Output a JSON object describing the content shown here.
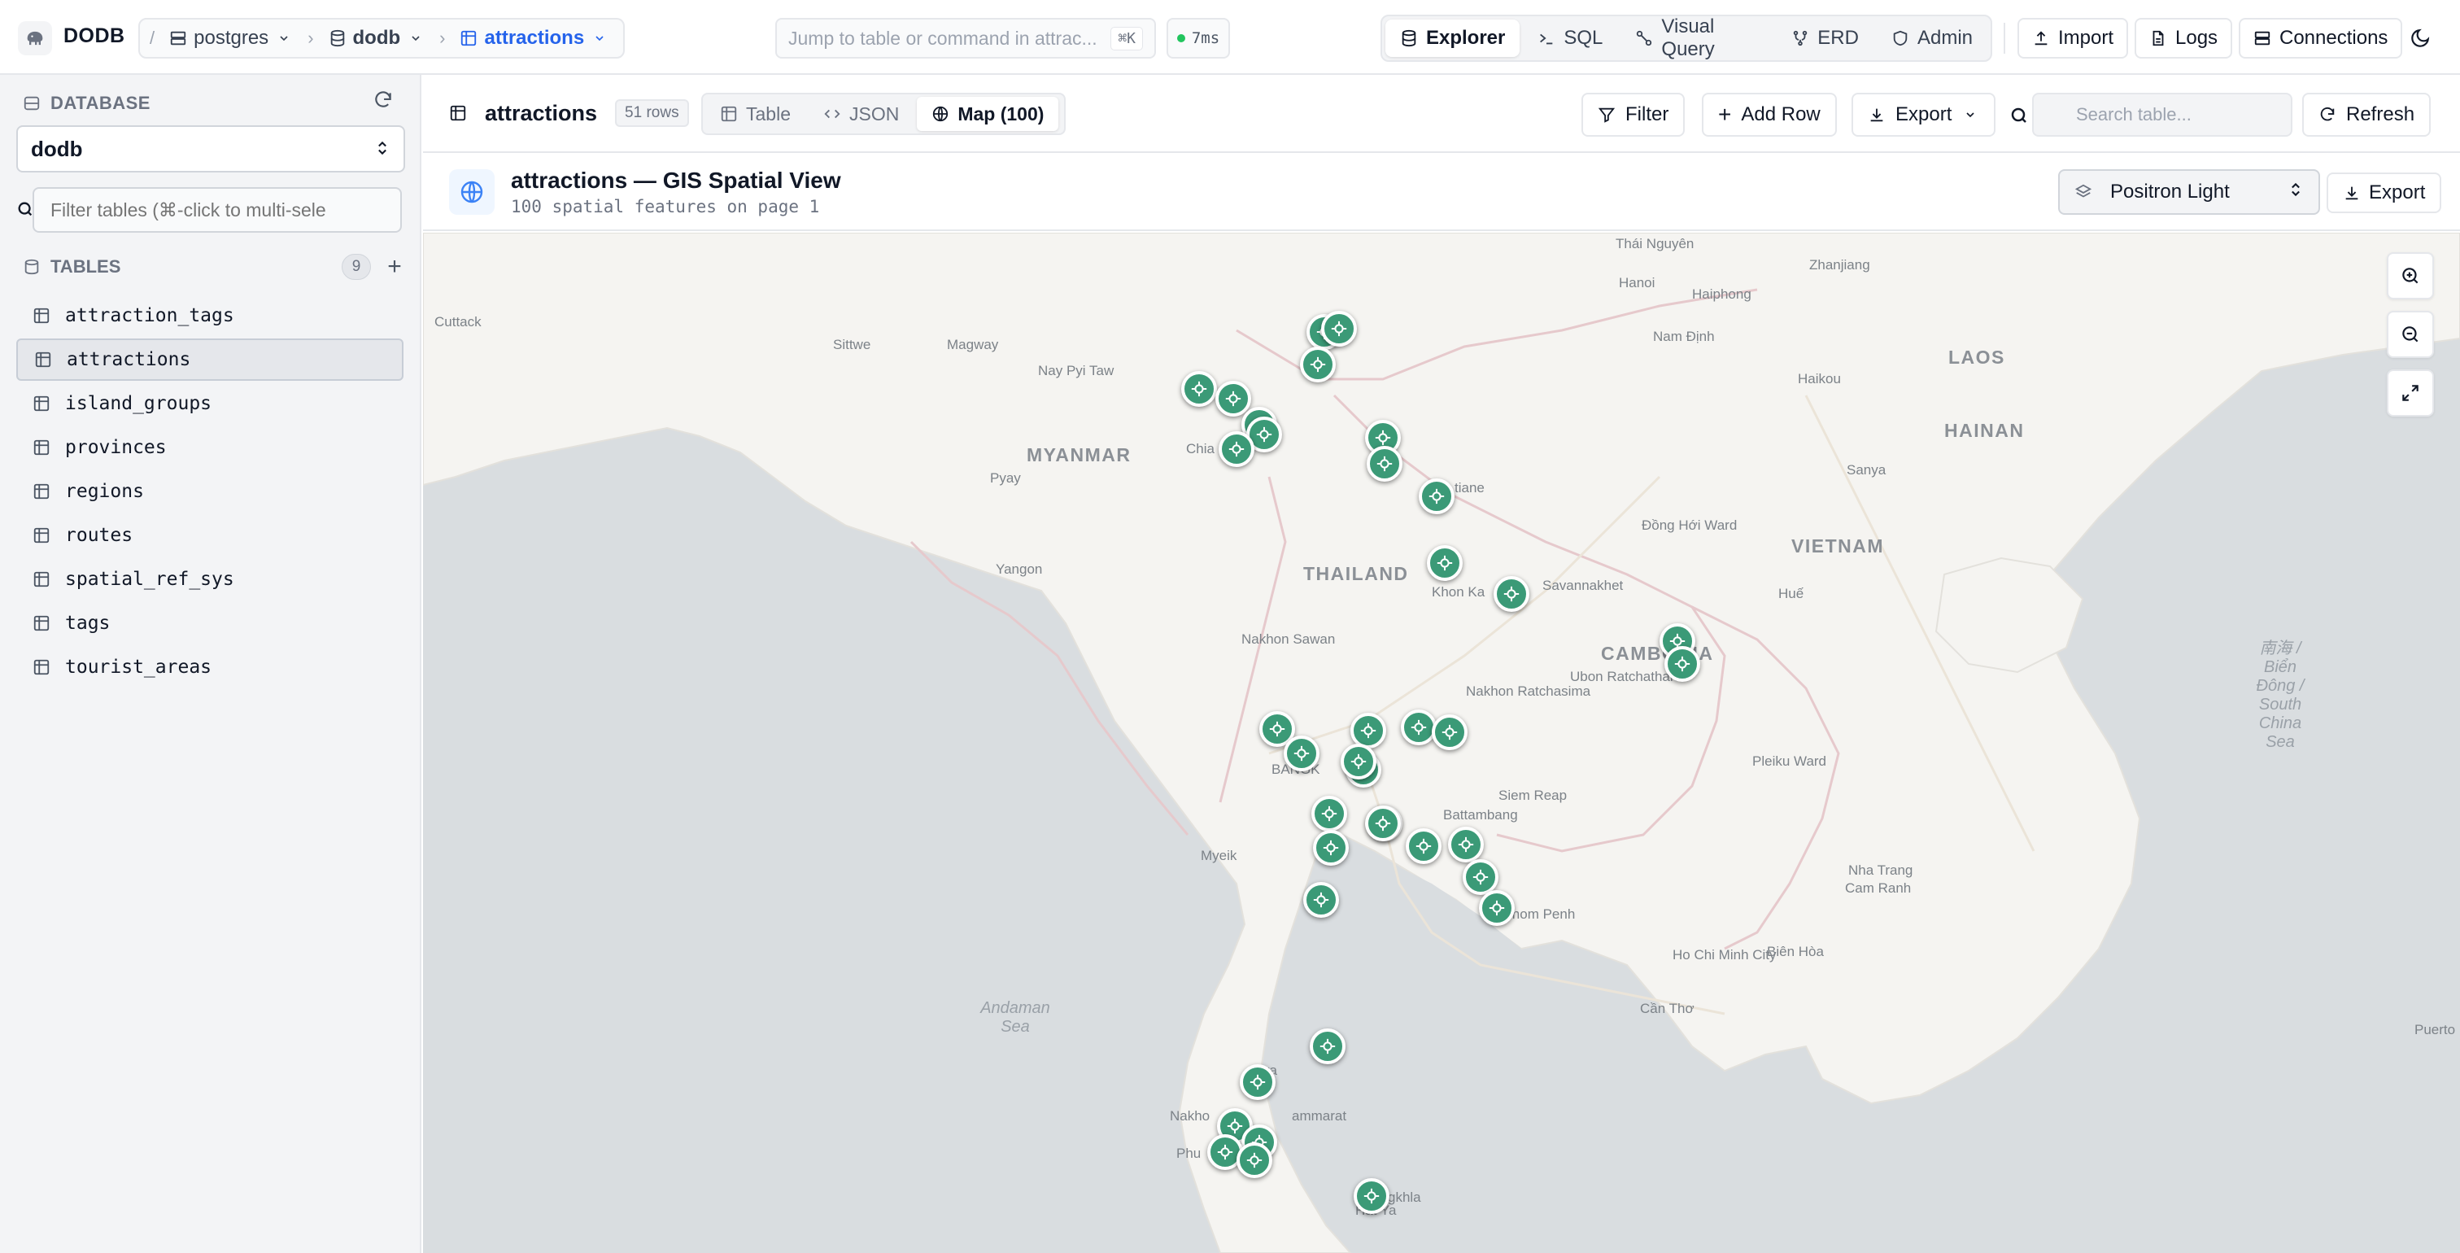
{
  "app": {
    "brand": "DODB"
  },
  "breadcrumb": {
    "server": "postgres",
    "database": "dodb",
    "table": "attractions"
  },
  "command": {
    "placeholder": "Jump to table or command in attrac...",
    "shortcut": "⌘K"
  },
  "latency": "7ms",
  "modes": [
    {
      "label": "Explorer",
      "icon": "database-icon"
    },
    {
      "label": "SQL",
      "icon": "terminal-icon"
    },
    {
      "label": "Visual Query",
      "icon": "graph-icon"
    },
    {
      "label": "ERD",
      "icon": "erd-icon"
    },
    {
      "label": "Admin",
      "icon": "shield-icon"
    }
  ],
  "topActions": {
    "import": "Import",
    "logs": "Logs",
    "connections": "Connections"
  },
  "sidebar": {
    "database_title": "DATABASE",
    "selected_db": "dodb",
    "filter_placeholder": "Filter tables (⌘-click to multi-sele",
    "tables_title": "TABLES",
    "tables_count": "9",
    "tables": [
      "attraction_tags",
      "attractions",
      "island_groups",
      "provinces",
      "regions",
      "routes",
      "spatial_ref_sys",
      "tags",
      "tourist_areas"
    ],
    "active_table": "attractions"
  },
  "main": {
    "table_name": "attractions",
    "row_count": "51 rows",
    "views": {
      "table": "Table",
      "json": "JSON",
      "map": "Map (100)"
    },
    "actions": {
      "filter": "Filter",
      "add_row": "Add Row",
      "export": "Export",
      "refresh": "Refresh"
    },
    "search_placeholder": "Search table..."
  },
  "gis": {
    "title": "attractions — GIS Spatial View",
    "subtitle": "100 spatial features on page 1",
    "basemap": "Positron Light",
    "export": "Export"
  },
  "map_labels": {
    "countries": [
      "LAOS",
      "HAINAN",
      "MYANMAR",
      "VIETNAM",
      "THAILAND",
      "CAMBODIA"
    ],
    "cities": [
      "Thái Nguyên",
      "Hanoi",
      "Haiphong",
      "Zhanjiang",
      "Cuttack",
      "Sittwe",
      "Magway",
      "Nay Pyi Taw",
      "Nam Định",
      "Haikou",
      "Pyay",
      "Chia",
      "tiane",
      "Sanya",
      "Đồng Hới Ward",
      "Yangon",
      "Khon Ka",
      "Savannakhet",
      "Huế",
      "Nakhon Sawan",
      "Ubon Ratchathani",
      "Nakhon Ratchasima",
      "BANGK",
      "Pleiku Ward",
      "Siem Reap",
      "Battambang",
      "Myeik",
      "Nha Trang",
      "Cam Ranh",
      "Phnom Penh",
      "Ho Chi Minh City",
      "Biên Hòa",
      "Cần Thơ",
      "Sura",
      "Nakho",
      "ammarat",
      "Phu",
      "Hat Ya",
      "gkhla",
      "Puerto"
    ],
    "seas": [
      "Andaman Sea",
      "南海 / Biển Đông / South China Sea"
    ]
  },
  "map_controls": {
    "zoom_in": "zoom-in-icon",
    "zoom_out": "zoom-out-icon",
    "fullscreen": "expand-icon"
  },
  "colors": {
    "marker": "#3b9a77",
    "accent": "#2563eb",
    "water": "#d9dde0",
    "land": "#f5f4f1"
  }
}
